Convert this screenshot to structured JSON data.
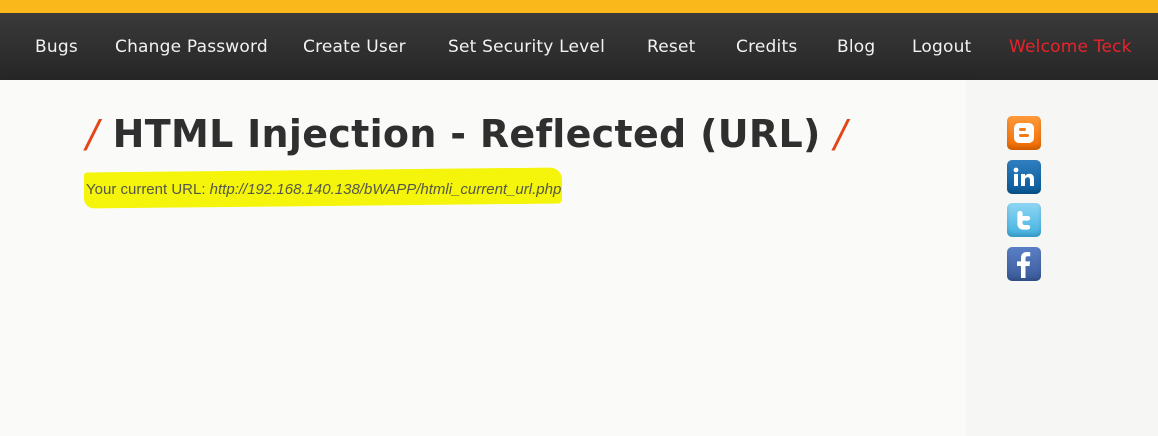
{
  "menu": {
    "items": [
      {
        "label": "Bugs"
      },
      {
        "label": "Change Password"
      },
      {
        "label": "Create User"
      },
      {
        "label": "Set Security Level"
      },
      {
        "label": "Reset"
      },
      {
        "label": "Credits"
      },
      {
        "label": "Blog"
      },
      {
        "label": "Logout"
      }
    ],
    "welcome": "Welcome Teck"
  },
  "page": {
    "title": "HTML Injection - Reflected (URL)",
    "slash": "/",
    "url_label": "Your current URL: ",
    "url_value": "http://192.168.140.138/bWAPP/htmli_current_url.php"
  },
  "social": {
    "icons": [
      "blogger-icon",
      "linkedin-icon",
      "twitter-icon",
      "facebook-icon"
    ]
  },
  "colors": {
    "accent": "#fbb81a",
    "welcome": "#e8232a",
    "slash": "#e2471c",
    "highlight": "#f4f50a"
  }
}
